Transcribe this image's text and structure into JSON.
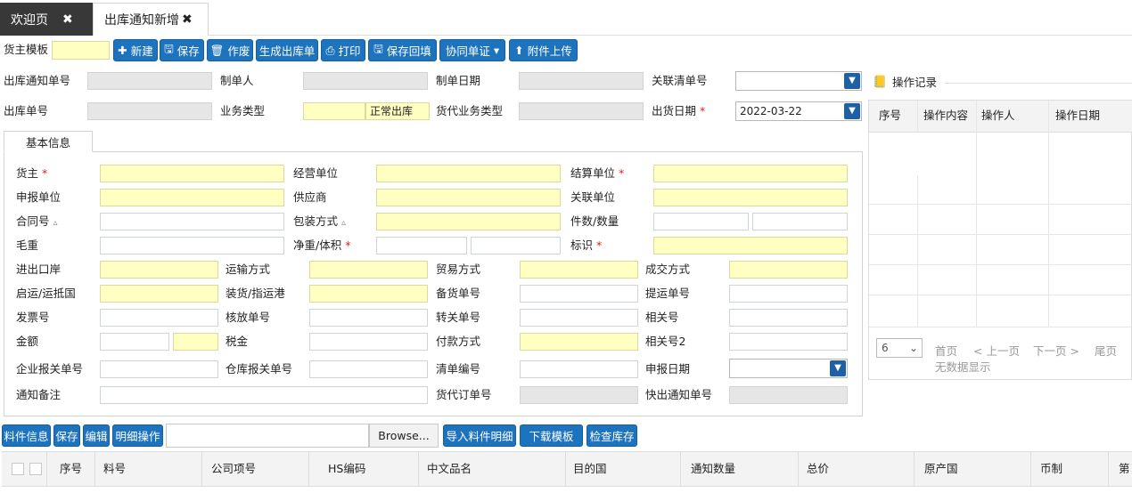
{
  "tabs": [
    {
      "label": "欢迎页",
      "close": "✖"
    },
    {
      "label": "出库通知新增",
      "close": "✖"
    }
  ],
  "toolbar": {
    "template_label": "货主模板",
    "new": "新建",
    "save": "保存",
    "void": "作废",
    "gen_outbound": "生成出库单",
    "print": "打印",
    "save_backfill": "保存回填",
    "co_doc": "协同单证",
    "attach": "附件上传"
  },
  "header_form": {
    "notice_no": "出库通知单号",
    "maker": "制单人",
    "make_date": "制单日期",
    "related_list": "关联清单号",
    "outbound_no": "出库单号",
    "biz_type": "业务类型",
    "biz_type_value": "正常出库",
    "agent_biz_type": "货代业务类型",
    "ship_date": "出货日期",
    "ship_date_value": "2022-03-22",
    "required": "*"
  },
  "op_log": {
    "title": "操作记录",
    "columns": [
      "序号",
      "操作内容",
      "操作人",
      "操作日期"
    ],
    "page_size": "6",
    "first": "首页",
    "prev": "< 上一页",
    "next": "下一页 >",
    "last": "尾页",
    "empty": "无数据显示"
  },
  "basic_tab": "基本信息",
  "basic": {
    "owner": "货主",
    "operator": "经营单位",
    "settle": "结算单位",
    "declare": "申报单位",
    "supplier": "供应商",
    "related_unit": "关联单位",
    "contract": "合同号",
    "tri": "▵",
    "packing": "包装方式",
    "pieces": "件数/数量",
    "gross": "毛重",
    "net": "净重/体积",
    "mark": "标识",
    "port": "进出口岸",
    "transport": "运输方式",
    "trade": "贸易方式",
    "deal": "成交方式",
    "country": "启运/运抵国",
    "load_port": "装货/指运港",
    "prep_no": "备货单号",
    "bol_no": "提运单号",
    "invoice": "发票号",
    "verify_no": "核放单号",
    "transfer_no": "转关单号",
    "rel_no": "相关号",
    "amount": "金额",
    "tax": "税金",
    "payment": "付款方式",
    "rel_no2": "相关号2",
    "ent_customs_no": "企业报关单号",
    "wh_customs_no": "仓库报关单号",
    "list_no": "清单编号",
    "declare_date": "申报日期",
    "notice_remark": "通知备注",
    "agent_order": "货代订单号",
    "express_notice": "快出通知单号"
  },
  "detail_toolbar": {
    "material_info": "料件信息",
    "save": "保存",
    "edit": "编辑",
    "detail_op": "明细操作",
    "browse": "Browse...",
    "import": "导入料件明细",
    "download": "下载模板",
    "check_stock": "检查库存"
  },
  "grid_columns": [
    "序号",
    "料号",
    "公司项号",
    "HS编码",
    "中文品名",
    "目的国",
    "通知数量",
    "总价",
    "原产国",
    "币制",
    "第"
  ]
}
